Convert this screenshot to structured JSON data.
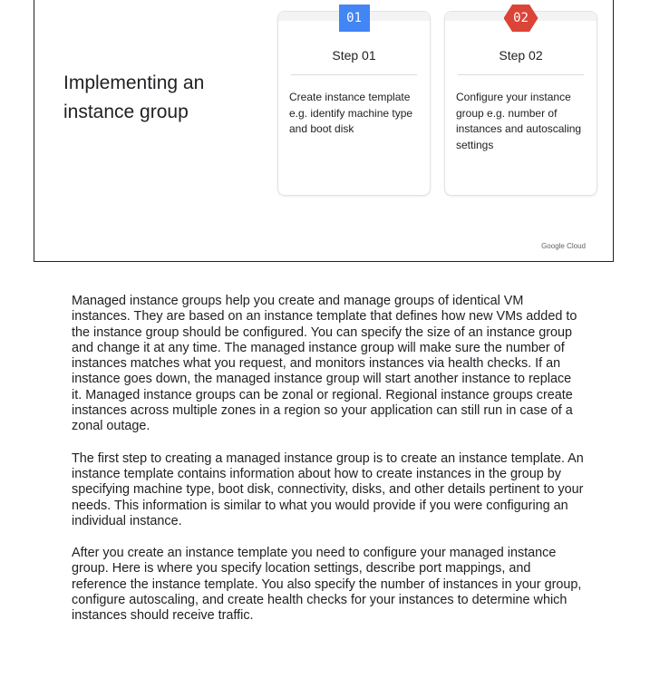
{
  "slide": {
    "title": "Implementing an instance group",
    "brand": "Google Cloud",
    "steps": [
      {
        "number": "01",
        "label": "Step 01",
        "description": "Create instance template e.g. identify machine type and boot disk",
        "badge_color": "#4285f4"
      },
      {
        "number": "02",
        "label": "Step 02",
        "description": "Configure your instance group e.g. number of instances and autoscaling settings",
        "badge_color": "#db4437"
      }
    ]
  },
  "notes": {
    "paragraphs": [
      "Managed instance groups help you create and manage groups of identical VM instances. They are based on an instance template that defines how new VMs added to the instance group should be configured. You can specify the size of an instance group and change it at any time. The managed instance group will make sure the number of instances matches what you request, and monitors instances via health checks. If  an instance goes down, the managed instance group will start another instance to replace it. Managed instance groups can be zonal or regional. Regional instance groups create instances across multiple zones in a region so your application can still run in case of a zonal outage.",
      "The first step to creating a managed instance group is to create an instance template. An instance template contains information about how to create instances in the group by specifying machine type, boot disk, connectivity, disks, and other details pertinent to your needs. This information is similar to what you would provide if you were configuring an individual instance.",
      "After you create an instance template you need to configure your managed instance group. Here is where you specify location settings, describe port mappings, and reference the instance template. You also specify the number of instances in your group, configure autoscaling, and create health checks for your instances to determine which instances should receive traffic."
    ]
  }
}
